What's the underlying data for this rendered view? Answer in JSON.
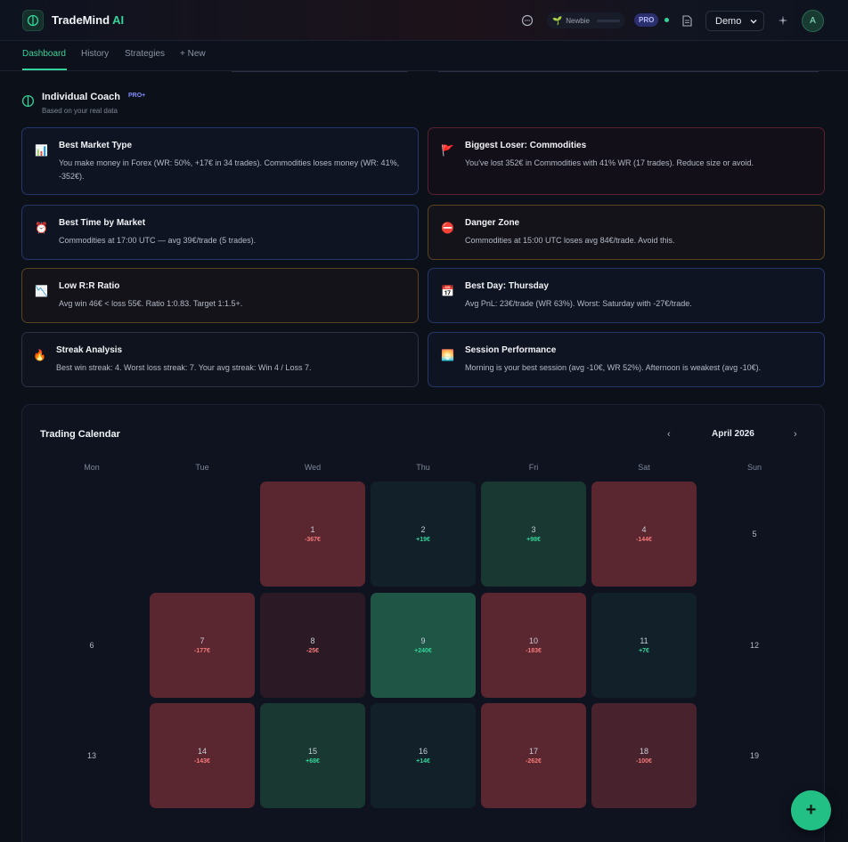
{
  "header": {
    "brand_main": "TradeMind",
    "brand_ai": "AI",
    "level_label": "Newbie",
    "pro_badge": "PRO",
    "account_select": "Demo",
    "avatar_initial": "A"
  },
  "tabs": [
    {
      "label": "Dashboard",
      "active": true
    },
    {
      "label": "History"
    },
    {
      "label": "Strategies"
    },
    {
      "label": "+ New"
    }
  ],
  "coach": {
    "title": "Individual Coach",
    "badge": "PRO+",
    "subtitle": "Based on your real data"
  },
  "cards": [
    {
      "emoji": "📊",
      "title": "Best Market Type",
      "body": "You make money in Forex (WR: 50%, +17€ in 34 trades). Commodities loses money (WR: 41%, -352€).",
      "tone": "blue"
    },
    {
      "emoji": "🚩",
      "title": "Biggest Loser: Commodities",
      "body": "You've lost 352€ in Commodities with 41% WR (17 trades). Reduce size or avoid.",
      "tone": "red"
    },
    {
      "emoji": "⏰",
      "title": "Best Time by Market",
      "body": "Commodities at 17:00 UTC — avg 39€/trade (5 trades).",
      "tone": "blue"
    },
    {
      "emoji": "⛔",
      "title": "Danger Zone",
      "body": "Commodities at 15:00 UTC loses avg 84€/trade. Avoid this.",
      "tone": "amber"
    },
    {
      "emoji": "📉",
      "title": "Low R:R Ratio",
      "body": "Avg win 46€ < loss 55€. Ratio 1:0.83. Target 1:1.5+.",
      "tone": "amber"
    },
    {
      "emoji": "📅",
      "title": "Best Day: Thursday",
      "body": "Avg PnL: 23€/trade (WR 63%). Worst: Saturday with -27€/trade.",
      "tone": "blue"
    },
    {
      "emoji": "🔥",
      "title": "Streak Analysis",
      "body": "Best win streak: 4. Worst loss streak: 7. Your avg streak: Win 4 / Loss 7.",
      "tone": "neutral"
    },
    {
      "emoji": "🌅",
      "title": "Session Performance",
      "body": "Morning is your best session (avg -10€, WR 52%). Afternoon is weakest (avg -10€).",
      "tone": "blue"
    }
  ],
  "calendar": {
    "title": "Trading Calendar",
    "month": "April 2026",
    "prev": "‹",
    "next": "›",
    "weekdays": [
      "Mon",
      "Tue",
      "Wed",
      "Thu",
      "Fri",
      "Sat",
      "Sun"
    ],
    "days": [
      {
        "day": "1",
        "pnl": "-367€",
        "tone": "loss-strong"
      },
      {
        "day": "2",
        "pnl": "+19€",
        "tone": "gain-weak"
      },
      {
        "day": "3",
        "pnl": "+98€",
        "tone": "gain-mid"
      },
      {
        "day": "4",
        "pnl": "-144€",
        "tone": "loss-strong"
      },
      {
        "day": "5",
        "pnl": "",
        "tone": "empty"
      },
      {
        "day": "6",
        "pnl": "",
        "tone": "empty"
      },
      {
        "day": "7",
        "pnl": "-177€",
        "tone": "loss-strong"
      },
      {
        "day": "8",
        "pnl": "-25€",
        "tone": "loss-weak"
      },
      {
        "day": "9",
        "pnl": "+240€",
        "tone": "gain-strong"
      },
      {
        "day": "10",
        "pnl": "-183€",
        "tone": "loss-strong"
      },
      {
        "day": "11",
        "pnl": "+7€",
        "tone": "gain-weak"
      },
      {
        "day": "12",
        "pnl": "",
        "tone": "empty"
      },
      {
        "day": "13",
        "pnl": "",
        "tone": "empty"
      },
      {
        "day": "14",
        "pnl": "-143€",
        "tone": "loss-strong"
      },
      {
        "day": "15",
        "pnl": "+68€",
        "tone": "gain-mid"
      },
      {
        "day": "16",
        "pnl": "+14€",
        "tone": "gain-weak"
      },
      {
        "day": "17",
        "pnl": "-262€",
        "tone": "loss-strong"
      },
      {
        "day": "18",
        "pnl": "-100€",
        "tone": "loss-mid"
      },
      {
        "day": "19",
        "pnl": "",
        "tone": "empty"
      }
    ],
    "colors": {
      "loss-strong": "#5a2630",
      "loss-mid": "#48222c",
      "loss-weak": "#2b1a25",
      "gain-weak": "#112029",
      "gain-mid": "#183831",
      "gain-strong": "#1f5545",
      "empty": "transparent",
      "loss-text": "#f47a7a",
      "gain-text": "#34d399"
    }
  },
  "fab": {
    "label": "+"
  }
}
